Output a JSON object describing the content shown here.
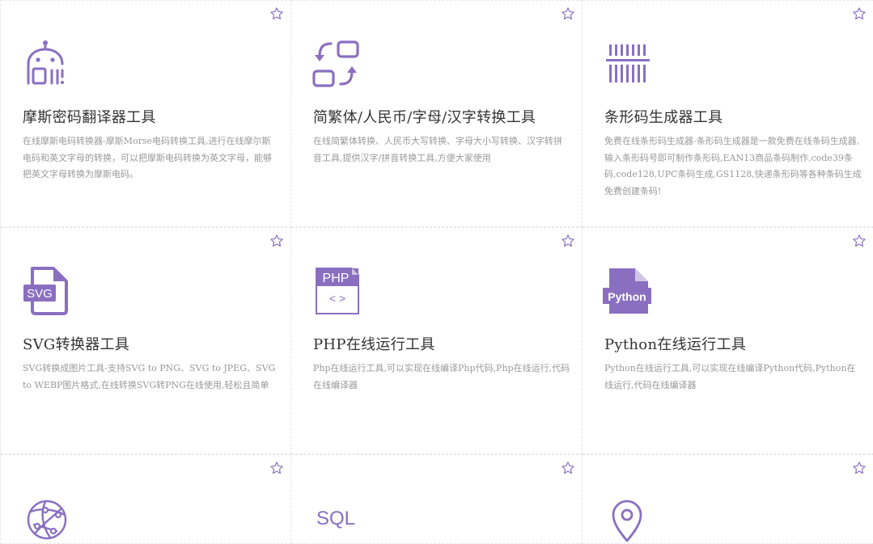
{
  "accent": "#8a6fc1",
  "cards": [
    {
      "title": "摩斯密码翻译器工具",
      "desc": "在线摩斯电码转换器-摩斯Morse电码转换工具,进行在线摩尔斯电码和英文字母的转换，可以把摩斯电码转换为英文字母，能够把英文字母转换为摩斯电码。",
      "icon": "robot-icon"
    },
    {
      "title": "简繁体/人民币/字母/汉字转换工具",
      "desc": "在线简繁体转换、人民币大写转换、字母大小写转换、汉字转拼音工具,提供汉字/拼音转换工具,方便大家使用",
      "icon": "convert-arrows-icon"
    },
    {
      "title": "条形码生成器工具",
      "desc": "免费在线条形码生成器-条形码生成器是一款免费在线条码生成器,输入条形码号即可制作条形码,EAN13商品条码制作,code39条码,code128,UPC条码生成,GS1128,快递条形码等各种条码生成免费创建条码!",
      "icon": "barcode-icon"
    },
    {
      "title": "SVG转换器工具",
      "desc": "SVG转换成图片工具-支持SVG to PNG、SVG to JPEG、SVG to WEBP图片格式,在线转换SVG转PNG在线使用,轻松且简单",
      "icon": "svg-file-icon",
      "icon_text": "SVG"
    },
    {
      "title": "PHP在线运行工具",
      "desc": "Php在线运行工具,可以实现在线编译Php代码,Php在线运行,代码在线编译器",
      "icon": "php-file-icon",
      "icon_text": "PHP",
      "icon_sub": "< >"
    },
    {
      "title": "Python在线运行工具",
      "desc": "Python在线运行工具,可以实现在线编译Python代码,Python在线运行,代码在线编译器",
      "icon": "python-file-icon",
      "icon_text": "Python"
    },
    {
      "title": "",
      "desc": "",
      "icon": "globe-network-icon"
    },
    {
      "title": "",
      "desc": "",
      "icon": "sql-icon",
      "icon_text": "SQL"
    },
    {
      "title": "",
      "desc": "",
      "icon": "location-pin-icon"
    }
  ]
}
